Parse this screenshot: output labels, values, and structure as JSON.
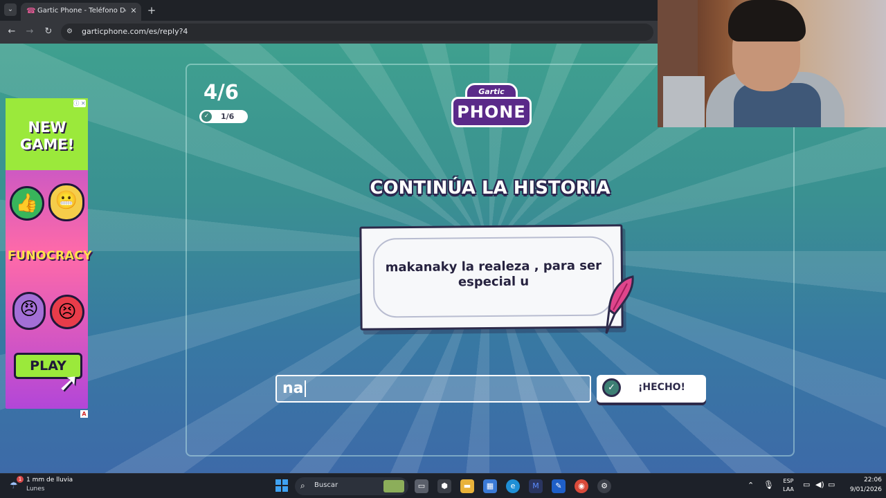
{
  "browser": {
    "tab_title": "Gartic Phone - Teléfono Descon",
    "tab_favicon": "☎",
    "url": "garticphone.com/es/reply?4",
    "icons": {
      "tab_list": "chevron-down-icon",
      "close": "close-icon",
      "new_tab": "plus-icon",
      "back": "arrow-left-icon",
      "forward": "arrow-right-icon",
      "reload": "reload-icon",
      "site_info": "tune-icon"
    }
  },
  "ad": {
    "headline": "NEW GAME!",
    "brand": "FUNOCRACY",
    "cta": "PLAY",
    "info_label": "ⓘ ✕",
    "badge": "A"
  },
  "game": {
    "round": "4/6",
    "done_count": "1/6",
    "logo_top": "Gartic",
    "logo_main": "PHONE",
    "heading": "CONTINÚA LA HISTORIA",
    "prompt": "makanaky la realeza , para ser especial u",
    "answer_value": "na",
    "done_button": "¡HECHO!",
    "colors": {
      "accent": "#3d7f74",
      "ink": "#2d2a4a",
      "brand_purple": "#5a2a89"
    }
  },
  "taskbar": {
    "weather_line1": "1 mm de lluvia",
    "weather_line2": "Lunes",
    "weather_alert": "1",
    "search_label": "Buscar",
    "lang_line1": "ESP",
    "lang_line2": "LAA",
    "time": "22:06",
    "date": "9/01/2026"
  }
}
